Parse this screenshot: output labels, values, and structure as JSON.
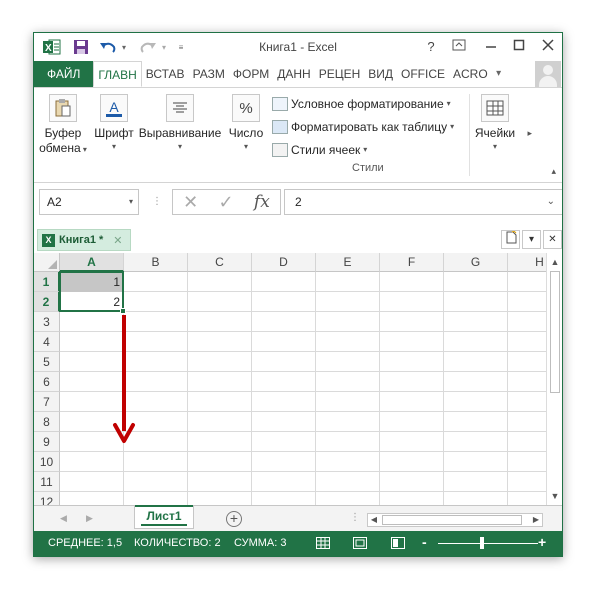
{
  "window": {
    "title": "Книга1 - Excel",
    "help_label": "?",
    "accent_color": "#217346"
  },
  "ribbon": {
    "tabs": [
      {
        "label": "ФАЙЛ",
        "type": "file"
      },
      {
        "label": "ГЛАВН",
        "type": "active"
      },
      {
        "label": "ВСТАВ",
        "type": "normal"
      },
      {
        "label": "РАЗМ",
        "type": "normal"
      },
      {
        "label": "ФОРМ",
        "type": "normal"
      },
      {
        "label": "ДАНН",
        "type": "normal"
      },
      {
        "label": "РЕЦЕН",
        "type": "normal"
      },
      {
        "label": "ВИД",
        "type": "normal"
      },
      {
        "label": "OFFICE",
        "type": "normal"
      },
      {
        "label": "ACRO",
        "type": "normal"
      }
    ],
    "groups": {
      "clipboard": {
        "line1": "Буфер",
        "line2": "обмена",
        "icon": "clipboard-icon"
      },
      "font": {
        "label": "Шрифт",
        "icon_text": "A"
      },
      "alignment": {
        "label": "Выравнивание",
        "icon": "align-icon"
      },
      "number": {
        "label": "Число",
        "icon_text": "%"
      },
      "cells": {
        "label": "Ячейки",
        "icon": "cells-icon"
      }
    },
    "styles": {
      "conditional": "Условное форматирование",
      "as_table": "Форматировать как таблицу",
      "cell_styles": "Стили ячеек",
      "caption": "Стили"
    }
  },
  "formula_bar": {
    "name_box": "A2",
    "value": "2",
    "fx": "fx"
  },
  "workbook_tab": {
    "label": "Книга1 *"
  },
  "sheet": {
    "columns": [
      "A",
      "B",
      "C",
      "D",
      "E",
      "F",
      "G",
      "H"
    ],
    "rows": [
      "1",
      "2",
      "3",
      "4",
      "5",
      "6",
      "7",
      "8",
      "9",
      "10",
      "11",
      "12"
    ],
    "selected_column": "A",
    "selected_rows": [
      "1",
      "2"
    ],
    "cells": {
      "A1": "1",
      "A2": "2"
    },
    "tabs": [
      "Лист1"
    ],
    "arrow_color": "#c00000"
  },
  "status": {
    "average": "СРЕДНЕЕ: 1,5",
    "count": "КОЛИЧЕСТВО: 2",
    "sum": "СУММА: 3"
  }
}
